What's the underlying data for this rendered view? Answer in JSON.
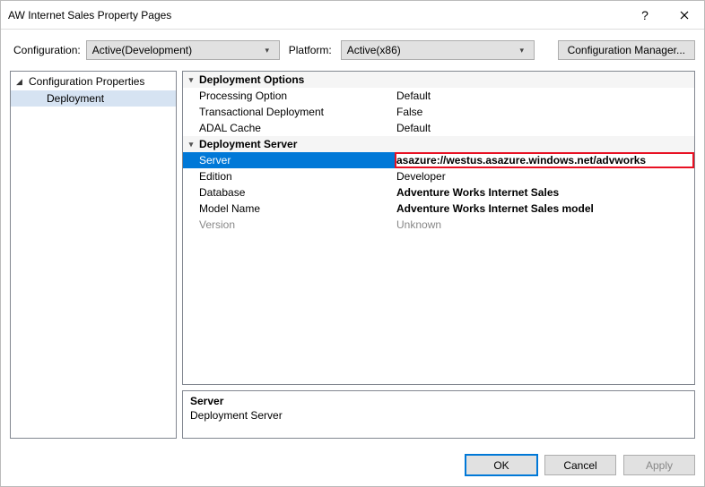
{
  "title": "AW Internet Sales Property Pages",
  "config_label": "Configuration:",
  "config_value": "Active(Development)",
  "platform_label": "Platform:",
  "platform_value": "Active(x86)",
  "config_manager_label": "Configuration Manager...",
  "tree": {
    "root": "Configuration Properties",
    "child": "Deployment"
  },
  "props": {
    "cat_deployment_options": "Deployment Options",
    "processing_option": {
      "name": "Processing Option",
      "value": "Default"
    },
    "transactional_deployment": {
      "name": "Transactional Deployment",
      "value": "False"
    },
    "adal_cache": {
      "name": "ADAL Cache",
      "value": "Default"
    },
    "cat_deployment_server": "Deployment Server",
    "server": {
      "name": "Server",
      "value": "asazure://westus.asazure.windows.net/advworks"
    },
    "edition": {
      "name": "Edition",
      "value": "Developer"
    },
    "database": {
      "name": "Database",
      "value": "Adventure Works Internet Sales"
    },
    "model_name": {
      "name": "Model Name",
      "value": "Adventure Works Internet Sales model"
    },
    "version": {
      "name": "Version",
      "value": "Unknown"
    }
  },
  "desc": {
    "title": "Server",
    "text": "Deployment Server"
  },
  "buttons": {
    "ok": "OK",
    "cancel": "Cancel",
    "apply": "Apply"
  }
}
